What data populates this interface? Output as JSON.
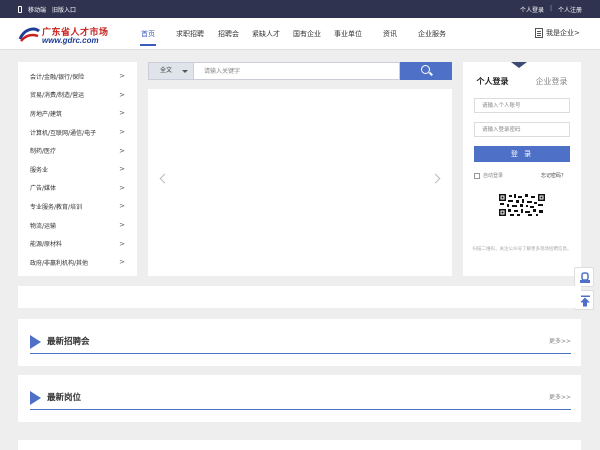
{
  "topbar": {
    "mobile": "移动端",
    "old_entry": "旧版入口",
    "personal_login": "个人登录",
    "divider": "|",
    "personal_register": "个人注册"
  },
  "logo": {
    "cn": "广东省人才市场",
    "en": "www.gdrc.com"
  },
  "nav": [
    "首页",
    "求职招聘",
    "招聘会",
    "紧缺人才",
    "国有企业",
    "事业单位",
    "资讯",
    "企业服务"
  ],
  "company_entry": "我是企业>",
  "categories": [
    "会计/金融/银行/保险",
    "贸易/消费/制造/营运",
    "房地产/建筑",
    "计算机/互联网/通信/电子",
    "制药/医疗",
    "服务业",
    "广告/媒体",
    "专业服务/教育/培训",
    "物流/运输",
    "能源/原材料",
    "政府/非赢利机构/其他"
  ],
  "cat_arrow": ">",
  "search": {
    "scope": "全文",
    "placeholder": "请输入关键字"
  },
  "login": {
    "tab_personal": "个人登录",
    "tab_company": "企业登录",
    "username_placeholder": "请输入个人账号",
    "password_placeholder": "请输入登录密码",
    "submit": "登 录",
    "auto_login": "自动登录",
    "forgot": "忘记密码？",
    "qr_tip": "扫描二维码，关注公众号了解更多现场招聘信息。"
  },
  "sections": [
    {
      "title": "最新招聘会",
      "more": "更多>>"
    },
    {
      "title": "最新岗位",
      "more": "更多>>"
    }
  ],
  "colors": {
    "topbar": "#2f3350",
    "accent": "#4e71c7",
    "logo_red": "#c8201c",
    "logo_blue": "#1d3d96"
  }
}
